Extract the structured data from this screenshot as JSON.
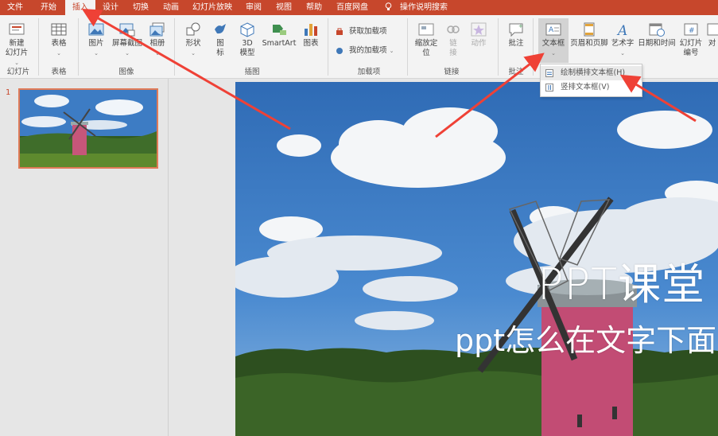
{
  "menu": {
    "items": [
      "文件",
      "开始",
      "插入",
      "设计",
      "切换",
      "动画",
      "幻灯片放映",
      "审阅",
      "视图",
      "帮助",
      "百度网盘"
    ],
    "active_index": 2,
    "search_label": "操作说明搜索"
  },
  "ribbon": {
    "slides": {
      "new_slide": "新建\n幻灯片",
      "group": "幻灯片"
    },
    "tables": {
      "table": "表格",
      "group": "表格"
    },
    "images": {
      "picture": "图片",
      "screenshot": "屏幕截图",
      "album": "相册",
      "group": "图像"
    },
    "illustrations": {
      "shapes": "形状",
      "icons": "图\n标",
      "model3d": "3D\n模型",
      "smartart": "SmartArt",
      "chart": "图表",
      "group": "插图"
    },
    "addins": {
      "get": "获取加载项",
      "mine": "我的加载项",
      "group": "加载项"
    },
    "links": {
      "zoom": "缩放定\n位",
      "link": "链\n接",
      "action": "动作",
      "group": "链接"
    },
    "comments": {
      "comment": "批注",
      "group": "批注"
    },
    "text": {
      "textbox": "文本框",
      "header_footer": "页眉和页脚",
      "wordart": "艺术字",
      "datetime": "日期和时间",
      "slide_number": "幻灯片\n编号",
      "object": "对"
    }
  },
  "textbox_menu": {
    "items": [
      "绘制横排文本框(H)",
      "竖排文本框(V)"
    ]
  },
  "thumbnails": {
    "number": "1"
  },
  "slide": {
    "title": "PPT课堂",
    "subtitle": "ppt怎么在文字下面"
  },
  "colors": {
    "accent": "#c7472c",
    "ribbon_bg": "#f3f3f3",
    "arrow": "#ef4136"
  }
}
